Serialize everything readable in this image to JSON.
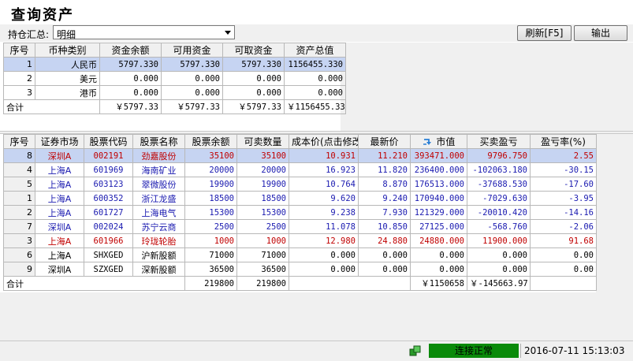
{
  "window": {
    "title": "查询资产"
  },
  "toolbar": {
    "summary_label": "持仓汇总:",
    "summary_value": "明细",
    "refresh_label": "刷新[F5]",
    "export_label": "输出"
  },
  "funds": {
    "headers": [
      "序号",
      "币种类别",
      "资金余额",
      "可用资金",
      "可取资金",
      "资产总值"
    ],
    "rows": [
      {
        "no": "1",
        "currency": "人民币",
        "balance": "5797.330",
        "available": "5797.330",
        "withdrawable": "5797.330",
        "total": "1156455.330"
      },
      {
        "no": "2",
        "currency": "美元",
        "balance": "0.000",
        "available": "0.000",
        "withdrawable": "0.000",
        "total": "0.000"
      },
      {
        "no": "3",
        "currency": "港币",
        "balance": "0.000",
        "available": "0.000",
        "withdrawable": "0.000",
        "total": "0.000"
      }
    ],
    "total": {
      "label": "合计",
      "balance": "￥5797.33",
      "available": "￥5797.33",
      "withdrawable": "￥5797.33",
      "total": "￥1156455.33"
    }
  },
  "positions": {
    "headers": [
      "序号",
      "证券市场",
      "股票代码",
      "股票名称",
      "股票余额",
      "可卖数量",
      "成本价(点击修改",
      "最新价",
      "市值",
      "买卖盈亏",
      "盈亏率(%)"
    ],
    "rows": [
      {
        "no": "8",
        "market": "深圳A",
        "code": "002191",
        "name": "劲嘉股份",
        "balance": "35100",
        "sellable": "35100",
        "cost": "10.931",
        "price": "11.210",
        "value": "393471.000",
        "pnl": "9796.750",
        "rate": "2.55",
        "color": "red"
      },
      {
        "no": "4",
        "market": "上海A",
        "code": "601969",
        "name": "海南矿业",
        "balance": "20000",
        "sellable": "20000",
        "cost": "16.923",
        "price": "11.820",
        "value": "236400.000",
        "pnl": "-102063.180",
        "rate": "-30.15",
        "color": "blue"
      },
      {
        "no": "5",
        "market": "上海A",
        "code": "603123",
        "name": "翠微股份",
        "balance": "19900",
        "sellable": "19900",
        "cost": "10.764",
        "price": "8.870",
        "value": "176513.000",
        "pnl": "-37688.530",
        "rate": "-17.60",
        "color": "blue"
      },
      {
        "no": "1",
        "market": "上海A",
        "code": "600352",
        "name": "浙江龙盛",
        "balance": "18500",
        "sellable": "18500",
        "cost": "9.620",
        "price": "9.240",
        "value": "170940.000",
        "pnl": "-7029.630",
        "rate": "-3.95",
        "color": "blue"
      },
      {
        "no": "2",
        "market": "上海A",
        "code": "601727",
        "name": "上海电气",
        "balance": "15300",
        "sellable": "15300",
        "cost": "9.238",
        "price": "7.930",
        "value": "121329.000",
        "pnl": "-20010.420",
        "rate": "-14.16",
        "color": "blue"
      },
      {
        "no": "7",
        "market": "深圳A",
        "code": "002024",
        "name": "苏宁云商",
        "balance": "2500",
        "sellable": "2500",
        "cost": "11.078",
        "price": "10.850",
        "value": "27125.000",
        "pnl": "-568.760",
        "rate": "-2.06",
        "color": "blue"
      },
      {
        "no": "3",
        "market": "上海A",
        "code": "601966",
        "name": "玲珑轮胎",
        "balance": "1000",
        "sellable": "1000",
        "cost": "12.980",
        "price": "24.880",
        "value": "24880.000",
        "pnl": "11900.000",
        "rate": "91.68",
        "color": "red"
      },
      {
        "no": "6",
        "market": "上海A",
        "code": "SHXGED",
        "name": "沪新股额",
        "balance": "71000",
        "sellable": "71000",
        "cost": "0.000",
        "price": "0.000",
        "value": "0.000",
        "pnl": "0.000",
        "rate": "0.00",
        "color": "black"
      },
      {
        "no": "9",
        "market": "深圳A",
        "code": "SZXGED",
        "name": "深新股额",
        "balance": "36500",
        "sellable": "36500",
        "cost": "0.000",
        "price": "0.000",
        "value": "0.000",
        "pnl": "0.000",
        "rate": "0.00",
        "color": "black"
      }
    ],
    "total": {
      "label": "合计",
      "balance": "219800",
      "sellable": "219800",
      "value": "￥1150658",
      "pnl": "￥-145663.97"
    }
  },
  "status": {
    "connection": "连接正常",
    "datetime": "2016-07-11 15:13:03",
    "connection_color": "#0a8a0a"
  }
}
